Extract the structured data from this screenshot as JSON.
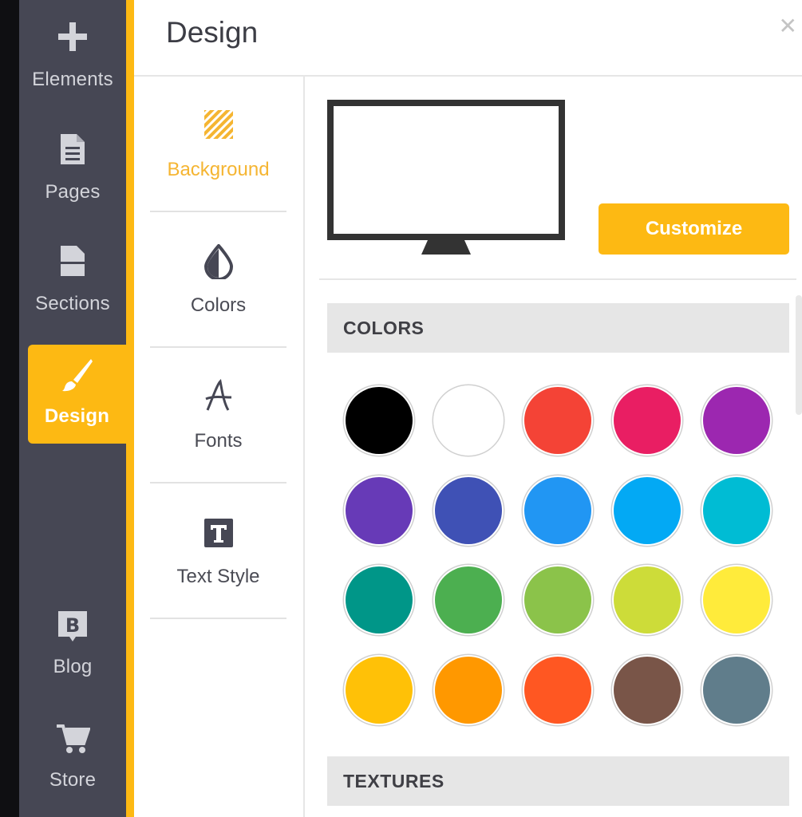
{
  "sidebar": {
    "items": [
      {
        "label": "Elements",
        "icon": "plus-icon"
      },
      {
        "label": "Pages",
        "icon": "page-icon"
      },
      {
        "label": "Sections",
        "icon": "section-icon"
      },
      {
        "label": "Design",
        "icon": "brush-icon",
        "active": true
      },
      {
        "label": "Blog",
        "icon": "blog-icon"
      },
      {
        "label": "Store",
        "icon": "cart-icon"
      }
    ]
  },
  "header": {
    "title": "Design",
    "close_icon": "close-icon"
  },
  "design_menu": {
    "items": [
      {
        "label": "Background",
        "icon": "background-hatch-icon",
        "active": true
      },
      {
        "label": "Colors",
        "icon": "color-drop-icon"
      },
      {
        "label": "Fonts",
        "icon": "font-icon"
      },
      {
        "label": "Text Style",
        "icon": "text-style-icon"
      }
    ]
  },
  "preview": {
    "icon": "monitor-icon",
    "customize_label": "Customize"
  },
  "colors": {
    "heading": "COLORS",
    "swatches": [
      "#000000",
      "#ffffff",
      "#f44336",
      "#e91e63",
      "#9c27b0",
      "#673ab7",
      "#3f51b5",
      "#2196f3",
      "#03a9f4",
      "#00bcd4",
      "#009688",
      "#4caf50",
      "#8bc34a",
      "#cddc39",
      "#ffeb3b",
      "#ffc107",
      "#ff9800",
      "#ff5722",
      "#795548",
      "#607d8b"
    ]
  },
  "textures": {
    "heading": "TEXTURES"
  },
  "theme": {
    "accent": "#fdb913",
    "sidebar": "#464754"
  }
}
